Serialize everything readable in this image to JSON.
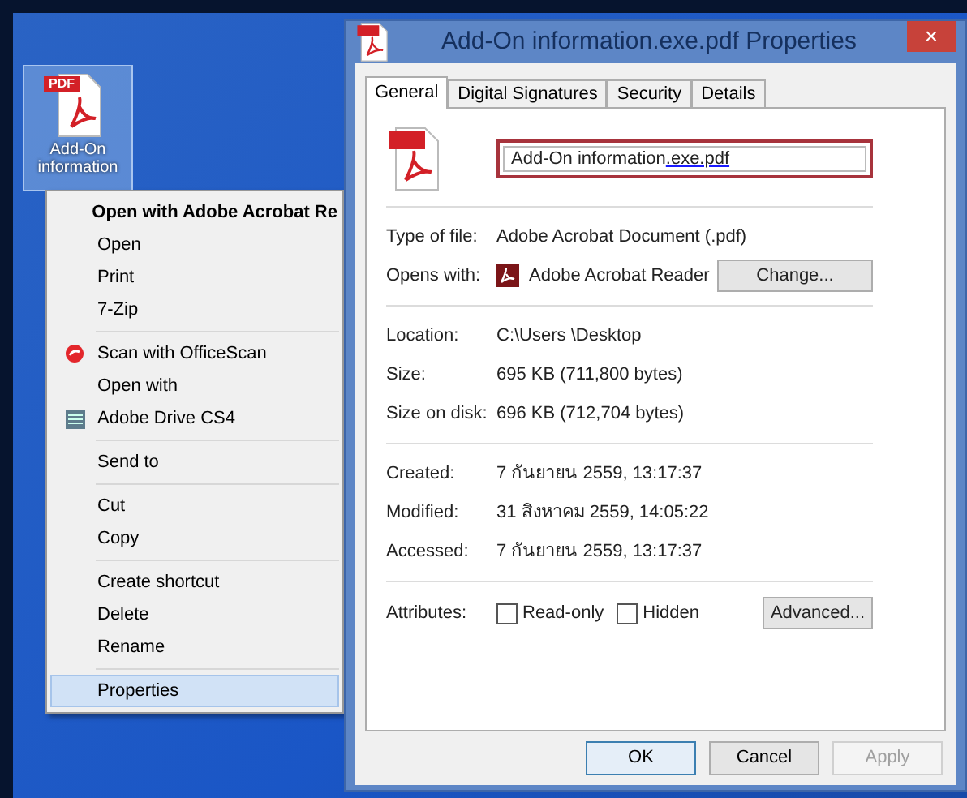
{
  "desktop_icon": {
    "label": "Add-On information",
    "badge": "PDF",
    "selected": true
  },
  "context_menu": {
    "groups": [
      [
        {
          "label": "Open with Adobe Acrobat Re",
          "default": true,
          "selected": false,
          "kind": "plain"
        },
        {
          "label": "Open",
          "default": false,
          "selected": false,
          "kind": "plain"
        },
        {
          "label": "Print",
          "default": false,
          "selected": false,
          "kind": "plain"
        },
        {
          "label": "7-Zip",
          "default": false,
          "selected": false,
          "kind": "plain"
        }
      ],
      [
        {
          "label": "Scan with OfficeScan",
          "default": false,
          "selected": false,
          "kind": "scan"
        },
        {
          "label": "Open with",
          "default": false,
          "selected": false,
          "kind": "plain"
        },
        {
          "label": "Adobe Drive CS4",
          "default": false,
          "selected": false,
          "kind": "drive"
        }
      ],
      [
        {
          "label": "Send to",
          "default": false,
          "selected": false,
          "kind": "plain"
        }
      ],
      [
        {
          "label": "Cut",
          "default": false,
          "selected": false,
          "kind": "plain"
        },
        {
          "label": "Copy",
          "default": false,
          "selected": false,
          "kind": "plain"
        }
      ],
      [
        {
          "label": "Create shortcut",
          "default": false,
          "selected": false,
          "kind": "plain"
        },
        {
          "label": "Delete",
          "default": false,
          "selected": false,
          "kind": "plain"
        },
        {
          "label": "Rename",
          "default": false,
          "selected": false,
          "kind": "plain"
        }
      ],
      [
        {
          "label": "Properties",
          "default": false,
          "selected": true,
          "kind": "plain"
        }
      ]
    ]
  },
  "window": {
    "title": "Add-On information.exe.pdf Properties",
    "close": "×"
  },
  "tabs": [
    {
      "label": "General",
      "selected": true
    },
    {
      "label": "Digital Signatures",
      "selected": false
    },
    {
      "label": "Security",
      "selected": false
    },
    {
      "label": "Details",
      "selected": false
    }
  ],
  "file_name": {
    "value": "Add-On information",
    "value_underlined": ".exe.pdf"
  },
  "sections": [
    [
      {
        "label": "Type of file:",
        "value": "Adobe Acrobat Document (.pdf)",
        "kind": "text"
      },
      {
        "label": "Opens with:",
        "value": "Adobe Acrobat Reader",
        "kind": "app",
        "button": "Change..."
      }
    ],
    [
      {
        "label": "Location:",
        "value": "C:\\Users \\Desktop",
        "kind": "text"
      },
      {
        "label": "Size:",
        "value": "695 KB (711,800 bytes)",
        "kind": "text"
      },
      {
        "label": "Size on disk:",
        "value": "696 KB (712,704 bytes)",
        "kind": "text"
      }
    ],
    [
      {
        "label": "Created:",
        "value": "7 กันยายน 2559, 13:17:37",
        "kind": "text"
      },
      {
        "label": "Modified:",
        "value": "31 สิงหาคม 2559, 14:05:22",
        "kind": "text"
      },
      {
        "label": "Accessed:",
        "value": "7 กันยายน 2559, 13:17:37",
        "kind": "text"
      }
    ]
  ],
  "attributes": {
    "label": "Attributes:",
    "checkboxes": [
      {
        "label": "Read-only",
        "checked": false
      },
      {
        "label": "Hidden",
        "checked": false
      }
    ],
    "button": "Advanced..."
  },
  "buttons": [
    {
      "label": "OK",
      "disabled": false,
      "default": true
    },
    {
      "label": "Cancel",
      "disabled": false,
      "default": false
    },
    {
      "label": "Apply",
      "disabled": true,
      "default": false
    }
  ]
}
